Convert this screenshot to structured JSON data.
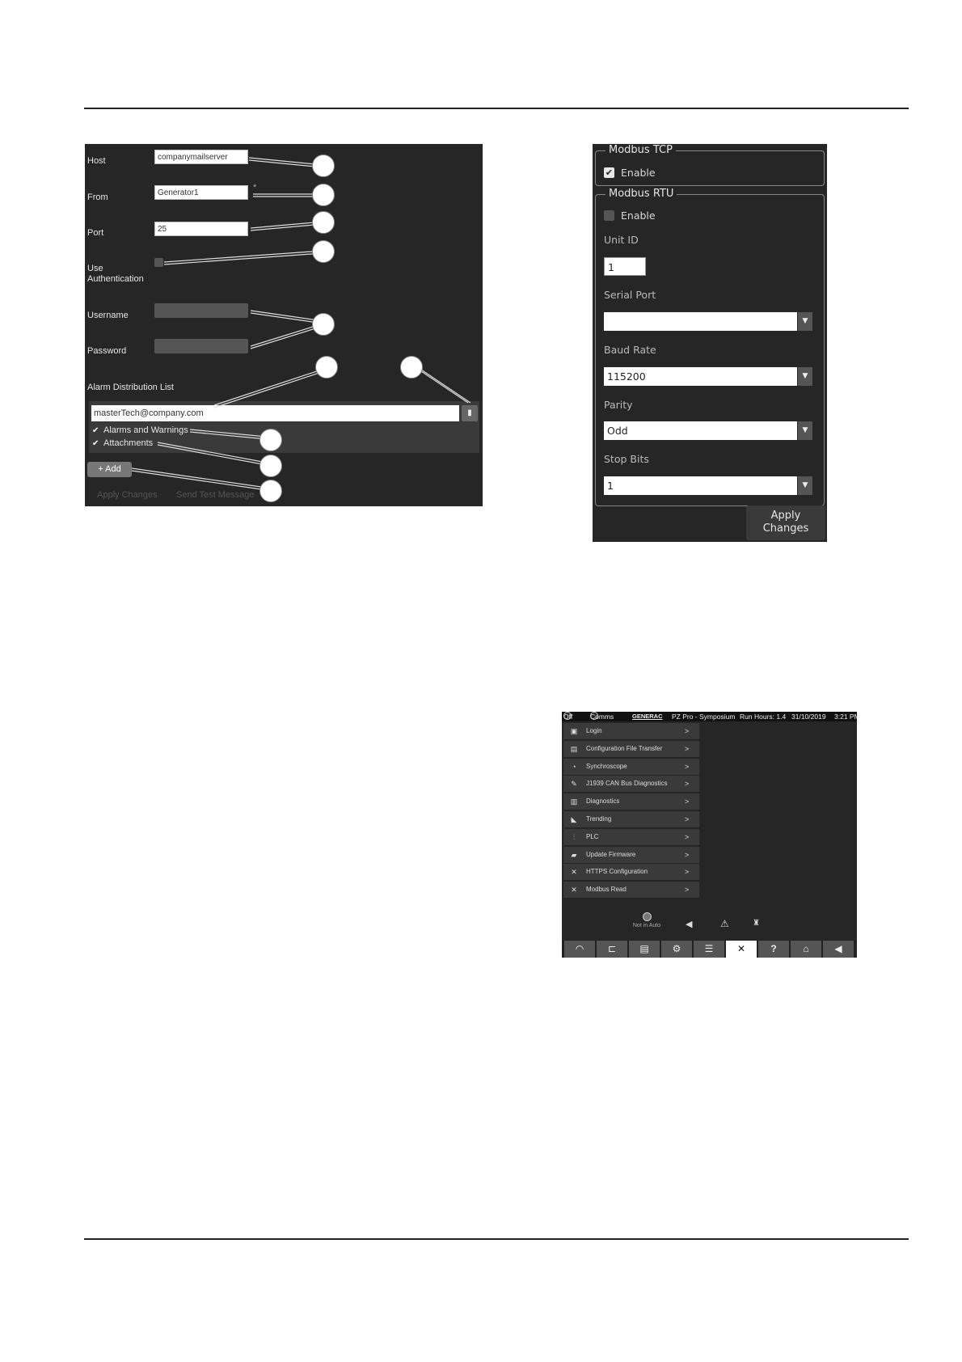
{
  "email_panel": {
    "host_label": "Host",
    "host_value": "companymailserver",
    "from_label": "From",
    "from_value": "Generator1",
    "from_marker": "*",
    "port_label": "Port",
    "port_value": "25",
    "auth_label_line1": "Use",
    "auth_label_line2": "Authentication",
    "username_label": "Username",
    "password_label": "Password",
    "alarm_list_label": "Alarm Distribution List",
    "email_entry": "masterTech@company.com",
    "option_alarms": "Alarms and Warnings",
    "option_attachments": "Attachments",
    "add_button": "Add",
    "apply_button": "Apply Changes",
    "send_test_button": "Send Test Message"
  },
  "modbus_panel": {
    "tcp_title": "Modbus TCP",
    "tcp_enable_label": "Enable",
    "tcp_enabled": true,
    "rtu_title": "Modbus RTU",
    "rtu_enable_label": "Enable",
    "rtu_enabled": false,
    "unit_id_label": "Unit ID",
    "unit_id_value": "1",
    "serial_port_label": "Serial Port",
    "serial_port_value": "",
    "baud_rate_label": "Baud Rate",
    "baud_rate_value": "115200",
    "parity_label": "Parity",
    "parity_value": "Odd",
    "stop_bits_label": "Stop Bits",
    "stop_bits_value": "1",
    "apply_line1": "Apply",
    "apply_line2": "Changes"
  },
  "controller": {
    "status": {
      "off": "Off",
      "comms": "Comms",
      "brand": "GENERAC",
      "model": "PZ Pro - Symposium",
      "run_hours": "Run Hours: 1.4",
      "date": "31/10/2019",
      "time": "3:21 PM"
    },
    "menu": [
      {
        "label": "Login",
        "icon": "id-card-icon",
        "glyph": "▣"
      },
      {
        "label": "Configuration File Transfer",
        "icon": "file-icon",
        "glyph": "▤"
      },
      {
        "label": "Synchroscope",
        "icon": "gauge-icon",
        "glyph": "◔"
      },
      {
        "label": "J1939 CAN Bus Diagnostics",
        "icon": "pen-icon",
        "glyph": "✎"
      },
      {
        "label": "Diagnostics",
        "icon": "monitor-icon",
        "glyph": "▥"
      },
      {
        "label": "Trending",
        "icon": "trend-icon",
        "glyph": "◣"
      },
      {
        "label": "PLC",
        "icon": "plc-icon",
        "glyph": "⫶"
      },
      {
        "label": "Update Firmware",
        "icon": "folder-icon",
        "glyph": "▰"
      },
      {
        "label": "HTTPS Configuration",
        "icon": "tools-icon",
        "glyph": "✕"
      },
      {
        "label": "Modbus Read",
        "icon": "tools-icon",
        "glyph": "✕"
      }
    ],
    "menu_arrow": ">",
    "mode_status": "Not in Auto",
    "nav": [
      "gauge-icon",
      "engine-icon",
      "generator-icon",
      "settings-icon",
      "sliders-icon",
      "tools-icon",
      "help-icon",
      "home-icon",
      "back-icon"
    ]
  }
}
